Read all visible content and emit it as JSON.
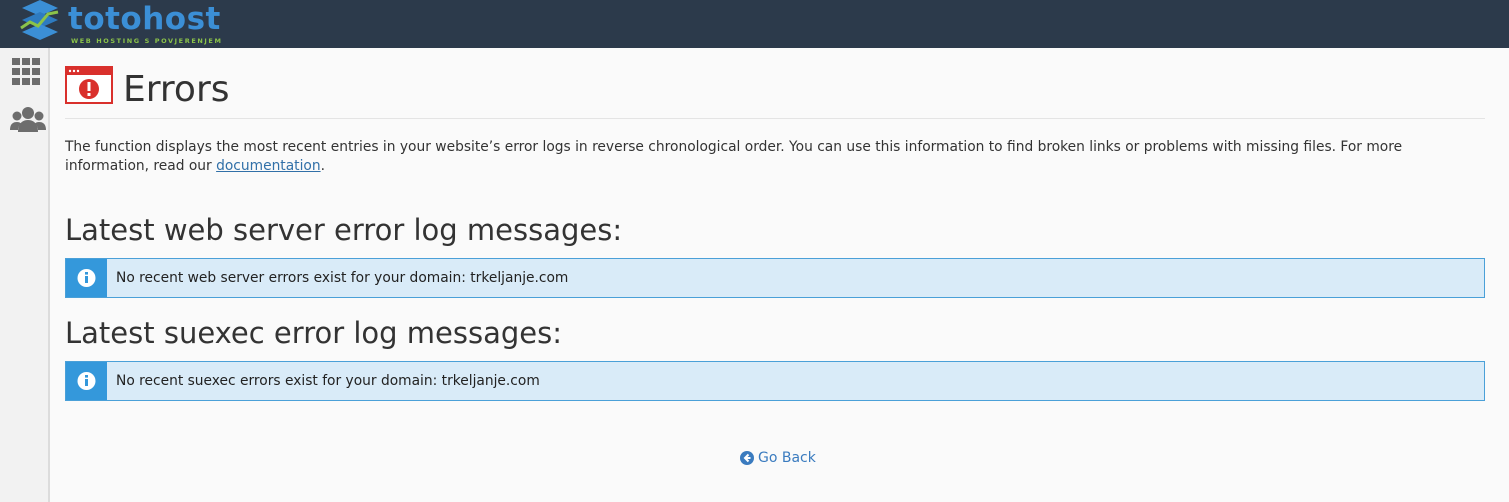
{
  "brand": {
    "name": "totohost",
    "tagline": "WEB HOSTING S POVJERENJEM"
  },
  "sidebar": {
    "items": [
      {
        "icon": "grid-icon",
        "label": ""
      },
      {
        "icon": "users-icon",
        "label": ""
      }
    ]
  },
  "page": {
    "title": "Errors",
    "description_before_link": "The function displays the most recent entries in your website’s error logs in reverse chronological order. You can use this information to find broken links or problems with missing files. For more information, read our ",
    "description_link": "documentation",
    "description_after_link": "."
  },
  "sections": [
    {
      "title": "Latest web server error log messages:",
      "message": "No recent web server errors exist for your domain: trkeljanje.com"
    },
    {
      "title": "Latest suexec error log messages:",
      "message": "No recent suexec errors exist for your domain: trkeljanje.com"
    }
  ],
  "actions": {
    "go_back": "Go Back"
  },
  "colors": {
    "topbar": "#2c3a4b",
    "brand_blue": "#3b8fd6",
    "brand_green": "#8bc34a",
    "alert_bg": "#d9ebf8",
    "alert_border": "#4aa0d8",
    "alert_icon_bg": "#3498db",
    "link": "#3170a8",
    "error_icon": "#d9302c"
  }
}
